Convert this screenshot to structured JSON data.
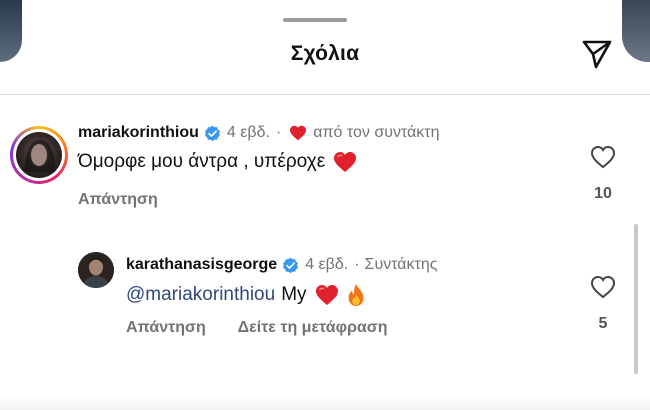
{
  "header": {
    "title": "Σχόλια",
    "send_icon": "paper-plane-icon"
  },
  "colors": {
    "verified": "#3897f0",
    "heart": "#e0202c",
    "mention": "#31487a",
    "muted": "#737373"
  },
  "comments": [
    {
      "username": "mariakorinthiou",
      "verified": true,
      "age": "4 εβδ.",
      "dot": "·",
      "liked_by_author": "από τον συντάκτη",
      "text": "Όμορφε μου άντρα , υπέροχε",
      "emojis": [
        "red-heart"
      ],
      "reply_label": "Απάντηση",
      "like_count": "10"
    },
    {
      "username": "karathanasisgeorge",
      "verified": true,
      "age": "4 εβδ.",
      "dot": "·",
      "role": "Συντάκτης",
      "mention": "@mariakorinthiou",
      "text": "My",
      "emojis": [
        "red-heart",
        "fire"
      ],
      "reply_label": "Απάντηση",
      "translate_label": "Δείτε τη μετάφραση",
      "like_count": "5"
    }
  ]
}
